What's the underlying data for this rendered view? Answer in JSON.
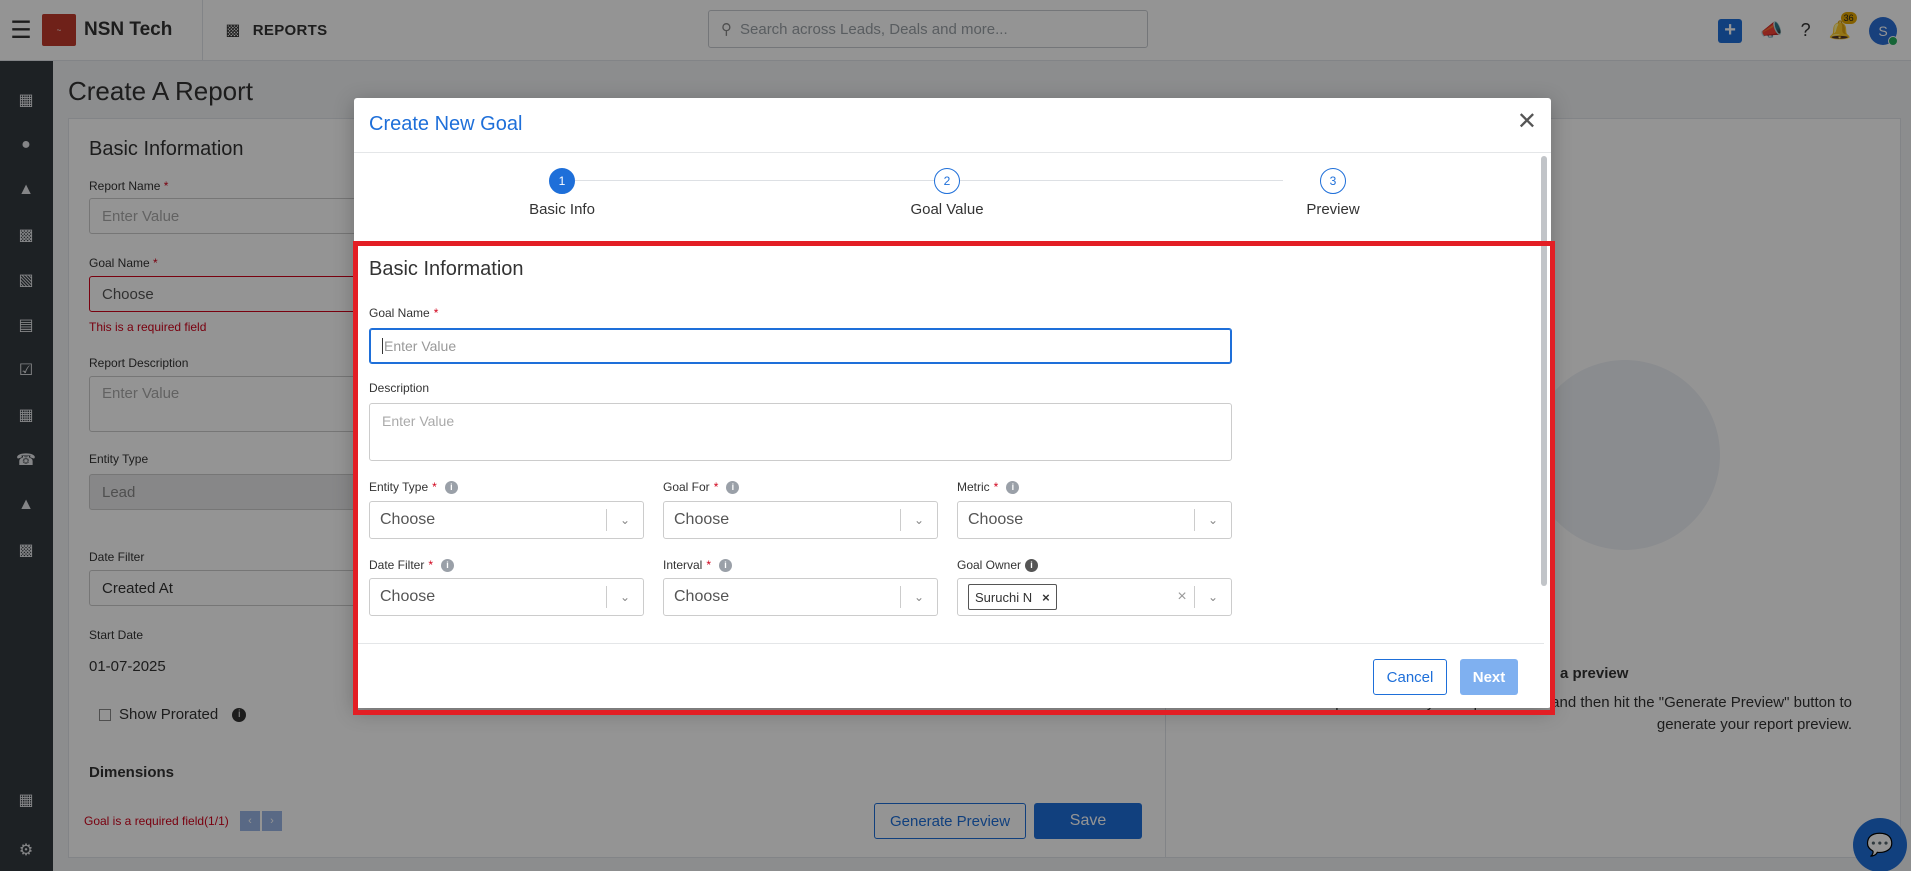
{
  "topbar": {
    "brand_name": "NSN Tech",
    "module_label": "REPORTS",
    "search_placeholder": "Search across Leads, Deals and more...",
    "notification_count": "36",
    "avatar_initial": "S"
  },
  "page": {
    "title": "Create A Report",
    "section_title": "Basic Information",
    "report_name_label": "Report Name",
    "report_name_placeholder": "Enter Value",
    "goal_name_label": "Goal Name",
    "goal_name_value": "Choose",
    "goal_name_error": "This is a required field",
    "report_desc_label": "Report Description",
    "report_desc_placeholder": "Enter Value",
    "entity_type_label": "Entity Type",
    "entity_type_value": "Lead",
    "date_filter_label": "Date Filter",
    "date_filter_value": "Created At",
    "start_date_label": "Start Date",
    "start_date_value": "01-07-2025",
    "show_prorated_label": "Show Prorated",
    "dimensions_label": "Dimensions",
    "footer_error": "Goal is a required field(1/1)",
    "generate_preview_label": "Generate Preview",
    "save_label": "Save",
    "preview_title": "a preview",
    "preview_desc": "- please select your report values and then hit the \"Generate Preview\" button to generate your report preview."
  },
  "modal": {
    "title": "Create New Goal",
    "steps": [
      {
        "number": "1",
        "label": "Basic Info"
      },
      {
        "number": "2",
        "label": "Goal Value"
      },
      {
        "number": "3",
        "label": "Preview"
      }
    ],
    "form_title": "Basic Information",
    "goal_name_label": "Goal Name",
    "goal_name_placeholder": "Enter Value",
    "description_label": "Description",
    "description_placeholder": "Enter Value",
    "entity_type_label": "Entity Type",
    "goal_for_label": "Goal For",
    "metric_label": "Metric",
    "date_filter_label": "Date Filter",
    "interval_label": "Interval",
    "goal_owner_label": "Goal Owner",
    "select_placeholder": "Choose",
    "goal_owner_tag": "Suruchi N",
    "cancel_label": "Cancel",
    "next_label": "Next"
  },
  "colors": {
    "primary": "#1e6fd9",
    "error": "#d0021b",
    "highlight": "#e31e24",
    "sidebar": "#33393f"
  }
}
